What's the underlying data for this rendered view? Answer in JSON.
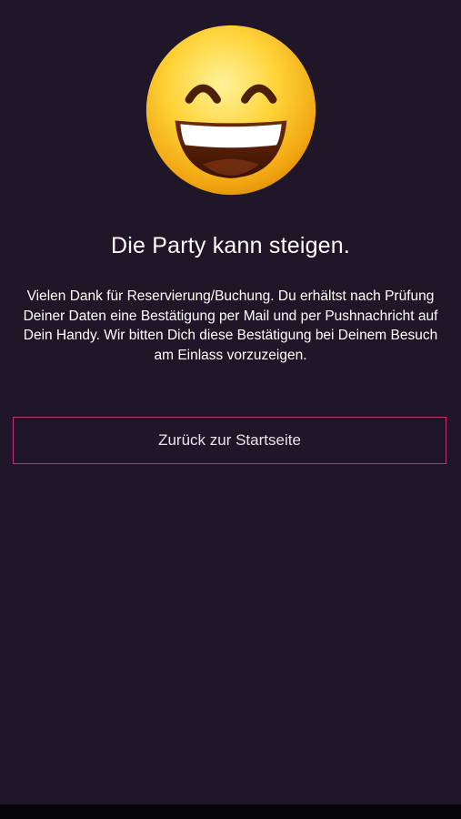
{
  "confirmation": {
    "emoji_icon": "grinning-face-smiling-eyes-icon",
    "title": "Die Party kann steigen.",
    "message": "Vielen Dank für Reservierung/Buchung. Du erhältst nach Prüfung Deiner Daten eine Bestätigung per Mail und per Pushnachricht auf Dein Handy. Wir bitten Dich diese Bestätigung bei Deinem Besuch am Einlass vorzuzeigen.",
    "back_button_label": "Zurück zur Startseite"
  },
  "colors": {
    "background": "#1f1628",
    "accent_border": "#c2307a",
    "text": "#ffffff"
  }
}
